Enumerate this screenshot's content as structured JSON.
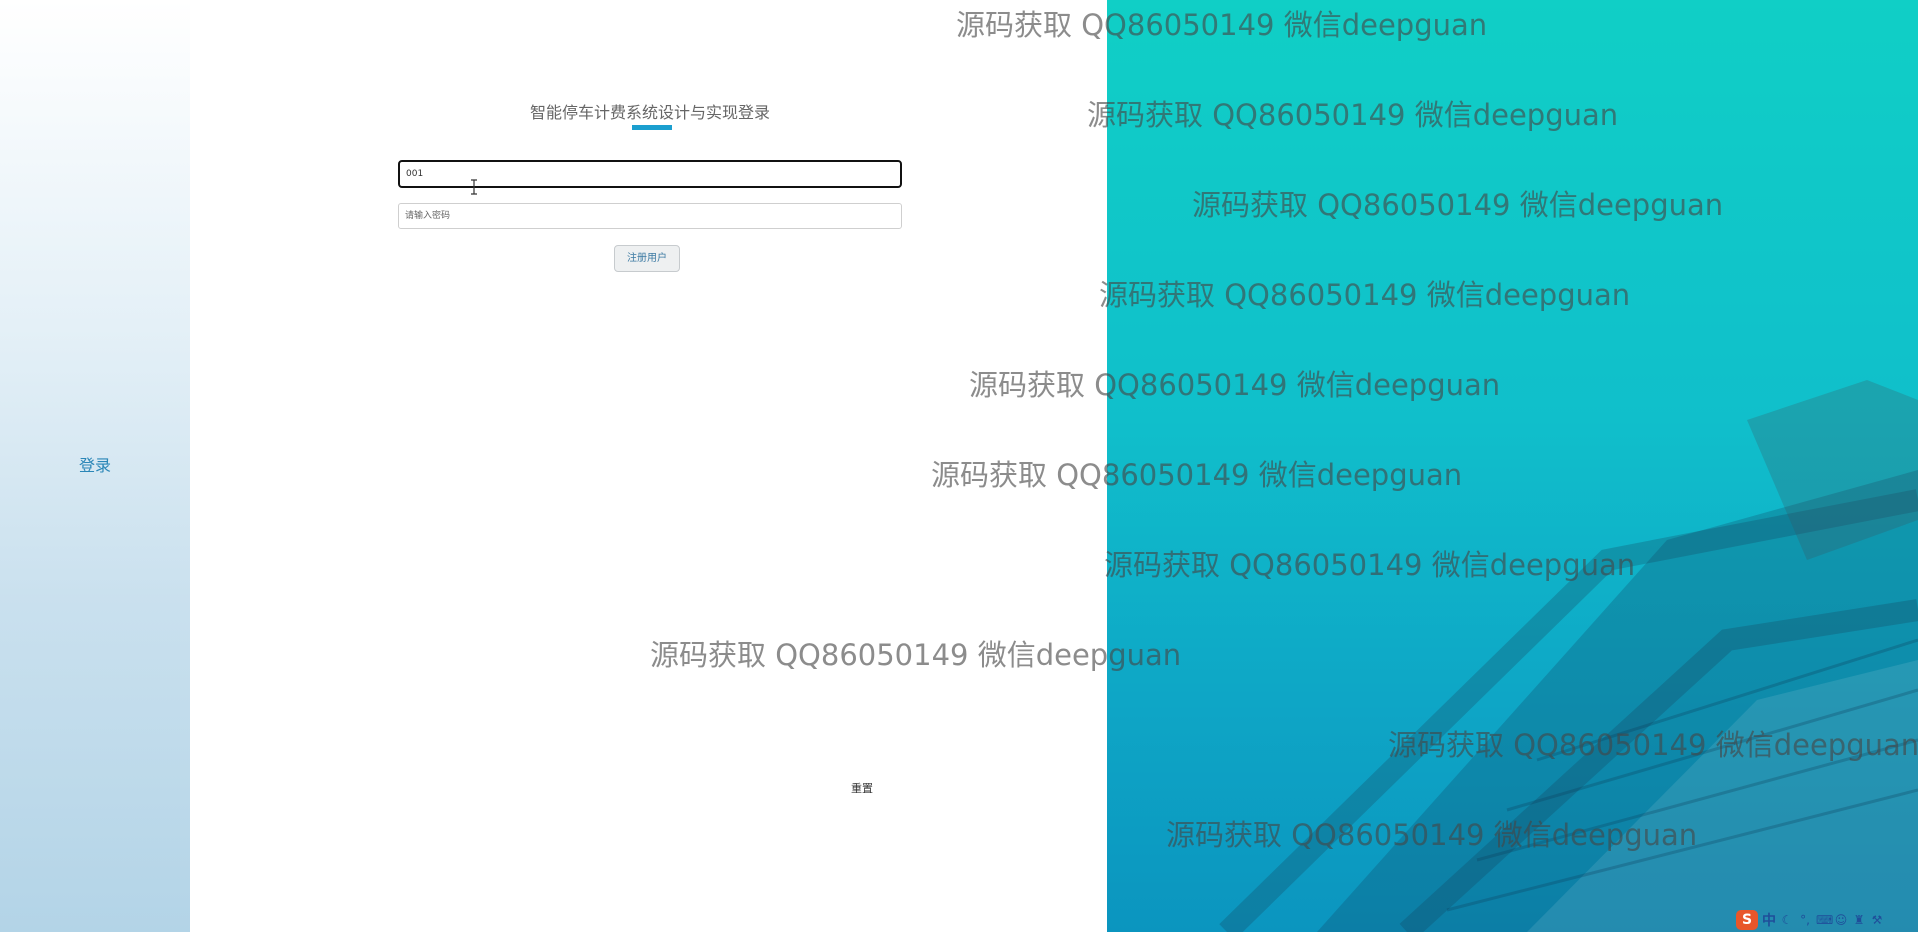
{
  "sidebar": {
    "login_label": "登录"
  },
  "form": {
    "title": "智能停车计费系统设计与实现登录",
    "username_value": "001",
    "password_placeholder": "请输入密码",
    "register_label": "注册用户",
    "reset_label": "重置"
  },
  "watermark": {
    "text": "源码获取 QQ86050149 微信deepguan",
    "count": 10
  },
  "tray": {
    "ime_logo": "S",
    "ime_mode": "中",
    "icons": [
      "moon-icon",
      "punctuation-icon",
      "keyboard-icon",
      "user-icon",
      "shirt-icon",
      "wrench-icon"
    ]
  },
  "colors": {
    "accent": "#1b9fcf",
    "teal": "#10bfcb",
    "link": "#2a86b7"
  }
}
